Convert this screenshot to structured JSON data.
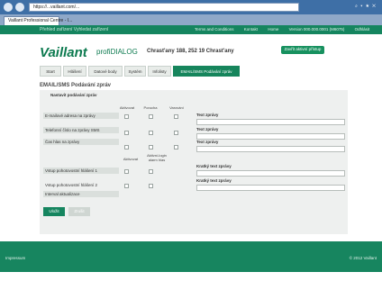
{
  "browser": {
    "address": "https://...vaillant.com/...",
    "tab_title": "Vaillant Professional Centre - I...",
    "right_icons": "⌕ ▾ ★ ✕"
  },
  "app_top": {
    "left_text": "Přehled zařízení  Vyhledat zařízení",
    "links": [
      "Terms and Conditions",
      "Kontakt",
      "Home",
      "Version 000.000.0001 (M6075)",
      "Odhlásit"
    ]
  },
  "header": {
    "logo": "Vaillant",
    "product_prefix": "profi",
    "product_suffix": "DIALOG",
    "address": "Chrast'any 188, 252 19 Chrast'any",
    "add_device": "Zavřít aktivní přístup"
  },
  "tabs": [
    "Start",
    "Hlášení",
    "Datové body",
    "Systém",
    "Infolisty",
    "EMAIL/SMS Podávání zpráv"
  ],
  "section_title": "EMAIL/SMS Podávání zpráv",
  "panel": {
    "title": "Nastavit podávání zpráv",
    "col_a": "Aktivovat",
    "col_b": "Porucha",
    "col_c": "Varování",
    "row_email": "E-mailové adresa na zprávy",
    "row_phone": "Telefonní číslo na zprávy SMS",
    "row_time": "Čas hlas na zprávy",
    "text_label": "Text zprávy",
    "col2_a": "Aktivovat",
    "col2_b": "Aktivní-login alarm hlas",
    "row_input1": "Vstup pohotovostní hlášení 1",
    "row_input2": "Vstup pohotovostní hlášení 2",
    "row_interval": "Interval aktualizace",
    "text_label2": "Kratký text zprávy"
  },
  "buttons": {
    "save": "Uložit",
    "cancel": "Zrušit"
  },
  "footer": {
    "left": "Impressum",
    "right": "© 2012 Vaillant"
  }
}
